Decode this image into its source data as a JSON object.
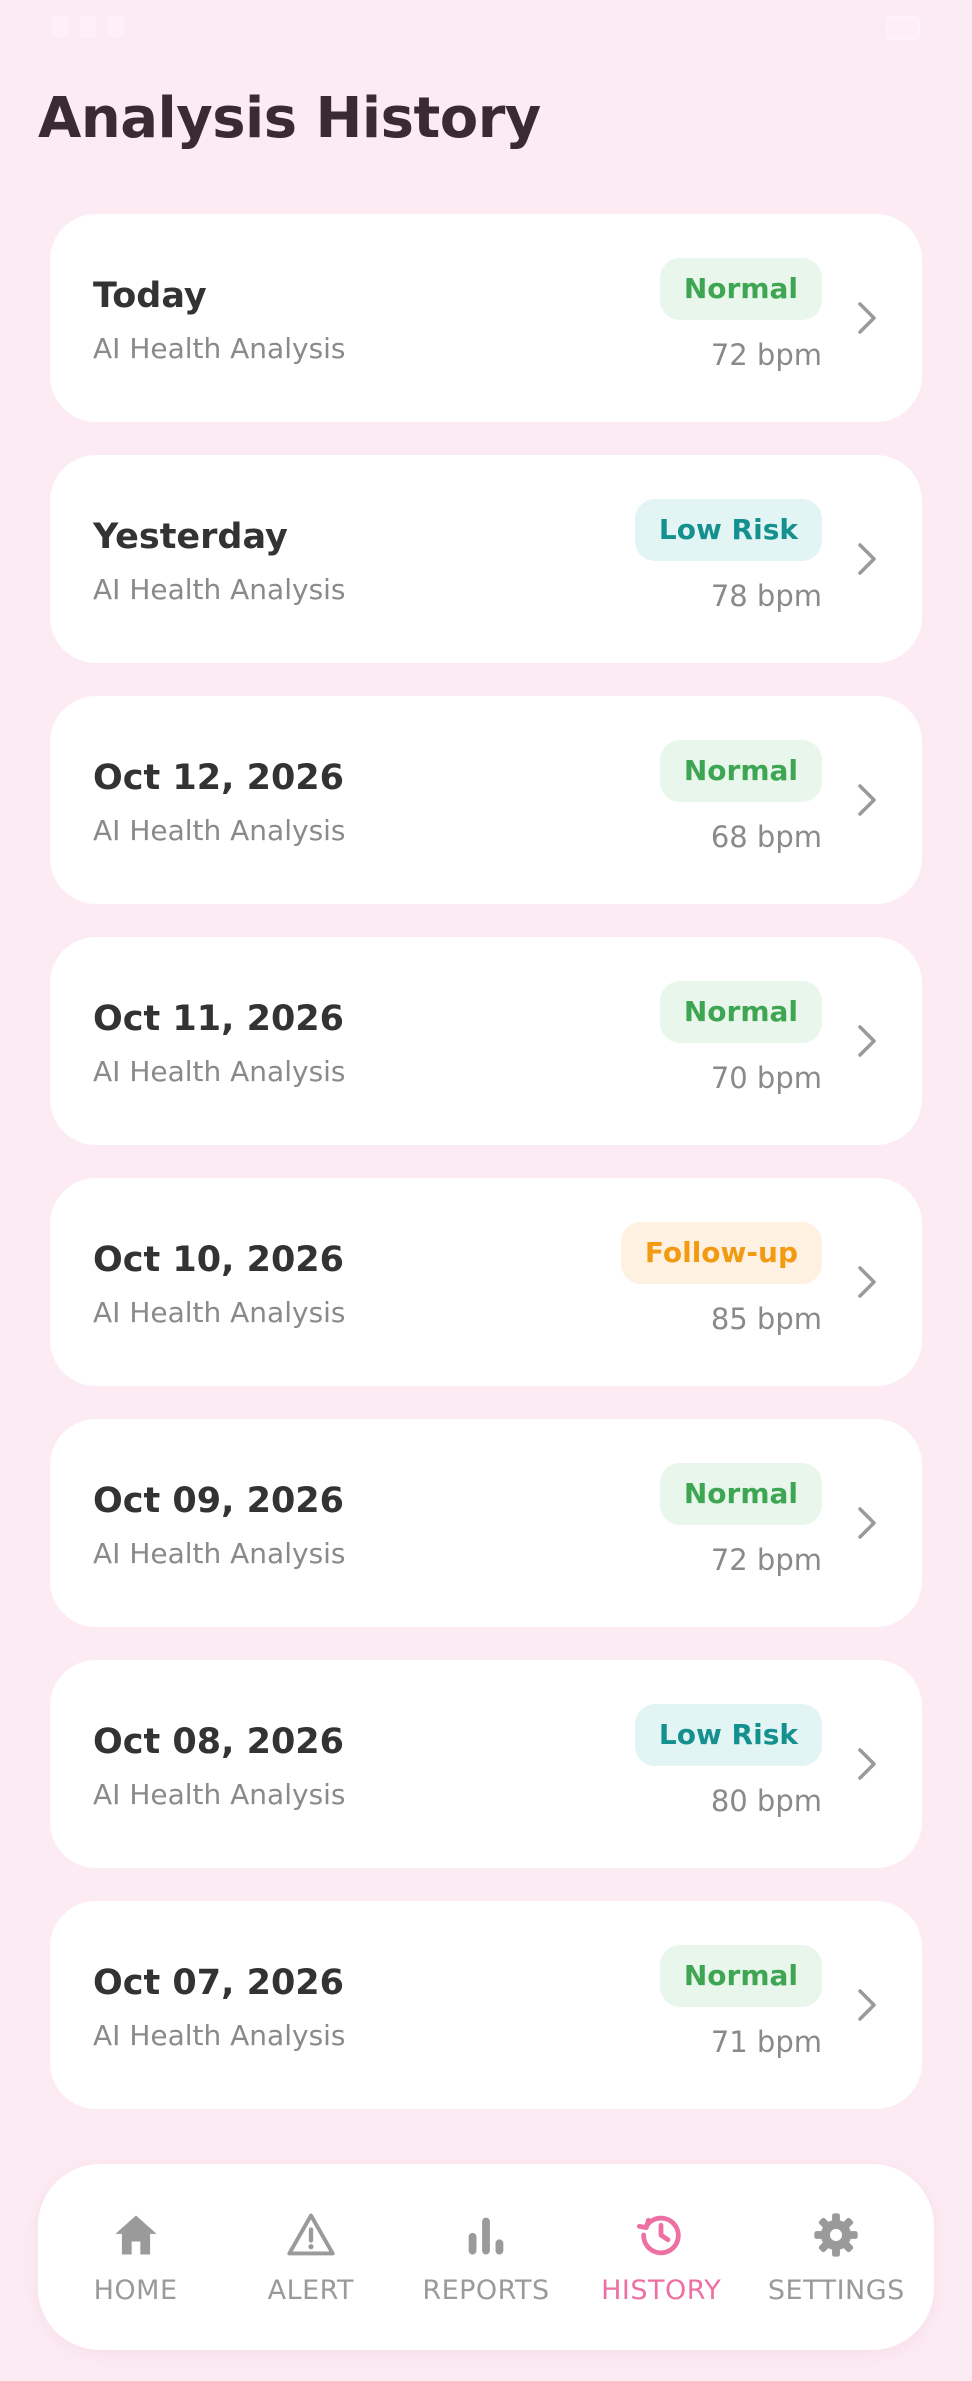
{
  "header": {
    "title": "Analysis History"
  },
  "history": [
    {
      "date": "Today",
      "subtitle": "AI Health Analysis",
      "status": "Normal",
      "status_kind": "normal",
      "bpm": "72 bpm"
    },
    {
      "date": "Yesterday",
      "subtitle": "AI Health Analysis",
      "status": "Low Risk",
      "status_kind": "lowrisk",
      "bpm": "78 bpm"
    },
    {
      "date": "Oct 12, 2026",
      "subtitle": "AI Health Analysis",
      "status": "Normal",
      "status_kind": "normal",
      "bpm": "68 bpm"
    },
    {
      "date": "Oct 11, 2026",
      "subtitle": "AI Health Analysis",
      "status": "Normal",
      "status_kind": "normal",
      "bpm": "70 bpm"
    },
    {
      "date": "Oct 10, 2026",
      "subtitle": "AI Health Analysis",
      "status": "Follow-up",
      "status_kind": "followup",
      "bpm": "85 bpm"
    },
    {
      "date": "Oct 09, 2026",
      "subtitle": "AI Health Analysis",
      "status": "Normal",
      "status_kind": "normal",
      "bpm": "72 bpm"
    },
    {
      "date": "Oct 08, 2026",
      "subtitle": "AI Health Analysis",
      "status": "Low Risk",
      "status_kind": "lowrisk",
      "bpm": "80 bpm"
    },
    {
      "date": "Oct 07, 2026",
      "subtitle": "AI Health Analysis",
      "status": "Normal",
      "status_kind": "normal",
      "bpm": "71 bpm"
    }
  ],
  "nav": {
    "items": [
      {
        "label": "HOME",
        "icon": "home-icon",
        "active": false
      },
      {
        "label": "ALERT",
        "icon": "alert-triangle-icon",
        "active": false
      },
      {
        "label": "REPORTS",
        "icon": "bar-chart-icon",
        "active": false
      },
      {
        "label": "HISTORY",
        "icon": "history-icon",
        "active": true
      },
      {
        "label": "SETTINGS",
        "icon": "gear-icon",
        "active": false
      }
    ]
  },
  "colors": {
    "background": "#fdebf3",
    "accent": "#ee6fa1",
    "normal": "#3ea653",
    "low_risk": "#14918f",
    "follow_up": "#f29a12"
  }
}
